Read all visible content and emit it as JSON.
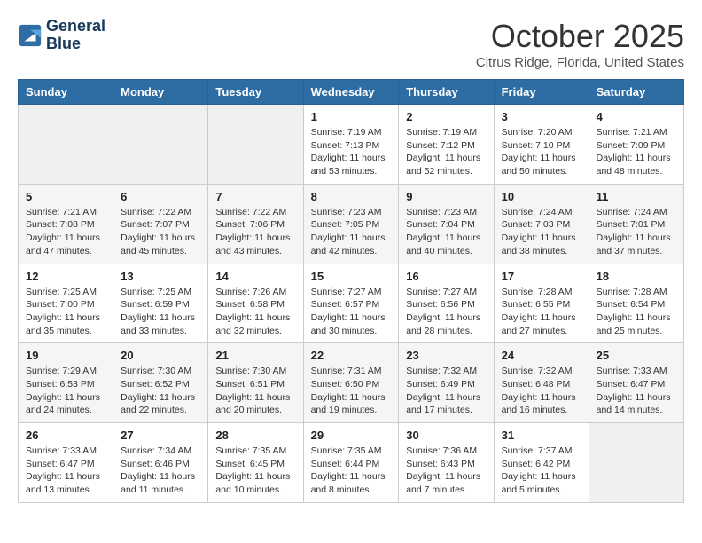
{
  "header": {
    "logo_line1": "General",
    "logo_line2": "Blue",
    "month": "October 2025",
    "location": "Citrus Ridge, Florida, United States"
  },
  "weekdays": [
    "Sunday",
    "Monday",
    "Tuesday",
    "Wednesday",
    "Thursday",
    "Friday",
    "Saturday"
  ],
  "weeks": [
    [
      {
        "day": "",
        "info": ""
      },
      {
        "day": "",
        "info": ""
      },
      {
        "day": "",
        "info": ""
      },
      {
        "day": "1",
        "info": "Sunrise: 7:19 AM\nSunset: 7:13 PM\nDaylight: 11 hours\nand 53 minutes."
      },
      {
        "day": "2",
        "info": "Sunrise: 7:19 AM\nSunset: 7:12 PM\nDaylight: 11 hours\nand 52 minutes."
      },
      {
        "day": "3",
        "info": "Sunrise: 7:20 AM\nSunset: 7:10 PM\nDaylight: 11 hours\nand 50 minutes."
      },
      {
        "day": "4",
        "info": "Sunrise: 7:21 AM\nSunset: 7:09 PM\nDaylight: 11 hours\nand 48 minutes."
      }
    ],
    [
      {
        "day": "5",
        "info": "Sunrise: 7:21 AM\nSunset: 7:08 PM\nDaylight: 11 hours\nand 47 minutes."
      },
      {
        "day": "6",
        "info": "Sunrise: 7:22 AM\nSunset: 7:07 PM\nDaylight: 11 hours\nand 45 minutes."
      },
      {
        "day": "7",
        "info": "Sunrise: 7:22 AM\nSunset: 7:06 PM\nDaylight: 11 hours\nand 43 minutes."
      },
      {
        "day": "8",
        "info": "Sunrise: 7:23 AM\nSunset: 7:05 PM\nDaylight: 11 hours\nand 42 minutes."
      },
      {
        "day": "9",
        "info": "Sunrise: 7:23 AM\nSunset: 7:04 PM\nDaylight: 11 hours\nand 40 minutes."
      },
      {
        "day": "10",
        "info": "Sunrise: 7:24 AM\nSunset: 7:03 PM\nDaylight: 11 hours\nand 38 minutes."
      },
      {
        "day": "11",
        "info": "Sunrise: 7:24 AM\nSunset: 7:01 PM\nDaylight: 11 hours\nand 37 minutes."
      }
    ],
    [
      {
        "day": "12",
        "info": "Sunrise: 7:25 AM\nSunset: 7:00 PM\nDaylight: 11 hours\nand 35 minutes."
      },
      {
        "day": "13",
        "info": "Sunrise: 7:25 AM\nSunset: 6:59 PM\nDaylight: 11 hours\nand 33 minutes."
      },
      {
        "day": "14",
        "info": "Sunrise: 7:26 AM\nSunset: 6:58 PM\nDaylight: 11 hours\nand 32 minutes."
      },
      {
        "day": "15",
        "info": "Sunrise: 7:27 AM\nSunset: 6:57 PM\nDaylight: 11 hours\nand 30 minutes."
      },
      {
        "day": "16",
        "info": "Sunrise: 7:27 AM\nSunset: 6:56 PM\nDaylight: 11 hours\nand 28 minutes."
      },
      {
        "day": "17",
        "info": "Sunrise: 7:28 AM\nSunset: 6:55 PM\nDaylight: 11 hours\nand 27 minutes."
      },
      {
        "day": "18",
        "info": "Sunrise: 7:28 AM\nSunset: 6:54 PM\nDaylight: 11 hours\nand 25 minutes."
      }
    ],
    [
      {
        "day": "19",
        "info": "Sunrise: 7:29 AM\nSunset: 6:53 PM\nDaylight: 11 hours\nand 24 minutes."
      },
      {
        "day": "20",
        "info": "Sunrise: 7:30 AM\nSunset: 6:52 PM\nDaylight: 11 hours\nand 22 minutes."
      },
      {
        "day": "21",
        "info": "Sunrise: 7:30 AM\nSunset: 6:51 PM\nDaylight: 11 hours\nand 20 minutes."
      },
      {
        "day": "22",
        "info": "Sunrise: 7:31 AM\nSunset: 6:50 PM\nDaylight: 11 hours\nand 19 minutes."
      },
      {
        "day": "23",
        "info": "Sunrise: 7:32 AM\nSunset: 6:49 PM\nDaylight: 11 hours\nand 17 minutes."
      },
      {
        "day": "24",
        "info": "Sunrise: 7:32 AM\nSunset: 6:48 PM\nDaylight: 11 hours\nand 16 minutes."
      },
      {
        "day": "25",
        "info": "Sunrise: 7:33 AM\nSunset: 6:47 PM\nDaylight: 11 hours\nand 14 minutes."
      }
    ],
    [
      {
        "day": "26",
        "info": "Sunrise: 7:33 AM\nSunset: 6:47 PM\nDaylight: 11 hours\nand 13 minutes."
      },
      {
        "day": "27",
        "info": "Sunrise: 7:34 AM\nSunset: 6:46 PM\nDaylight: 11 hours\nand 11 minutes."
      },
      {
        "day": "28",
        "info": "Sunrise: 7:35 AM\nSunset: 6:45 PM\nDaylight: 11 hours\nand 10 minutes."
      },
      {
        "day": "29",
        "info": "Sunrise: 7:35 AM\nSunset: 6:44 PM\nDaylight: 11 hours\nand 8 minutes."
      },
      {
        "day": "30",
        "info": "Sunrise: 7:36 AM\nSunset: 6:43 PM\nDaylight: 11 hours\nand 7 minutes."
      },
      {
        "day": "31",
        "info": "Sunrise: 7:37 AM\nSunset: 6:42 PM\nDaylight: 11 hours\nand 5 minutes."
      },
      {
        "day": "",
        "info": ""
      }
    ]
  ]
}
